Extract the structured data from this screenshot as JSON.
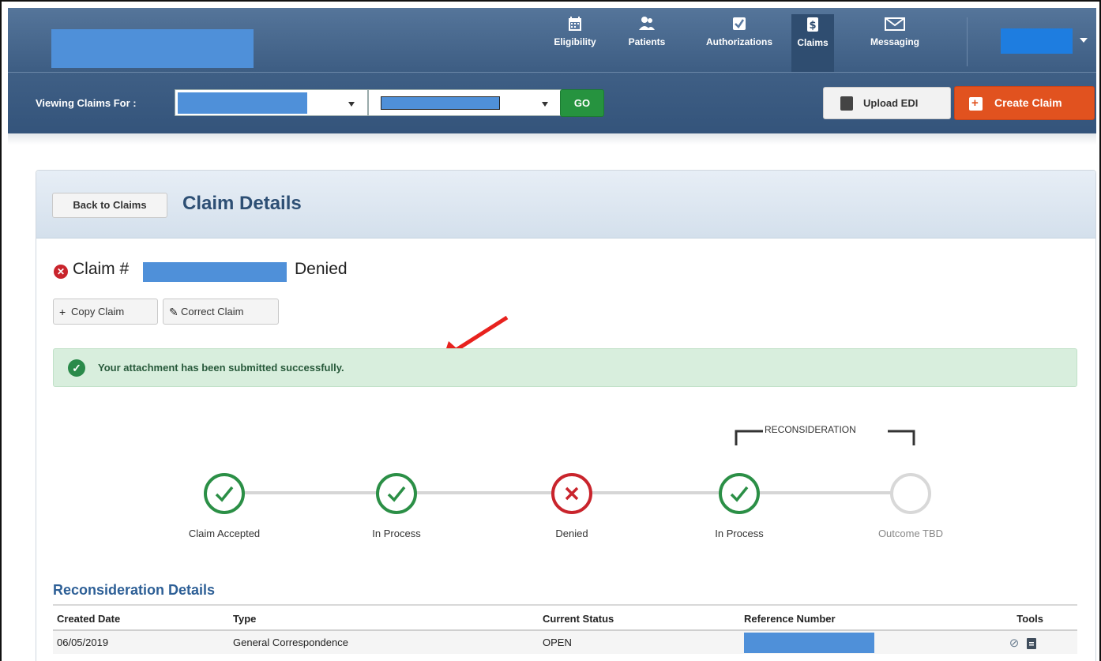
{
  "nav": {
    "items": [
      {
        "label": "Eligibility",
        "icon": "calendar-icon"
      },
      {
        "label": "Patients",
        "icon": "people-icon"
      },
      {
        "label": "Authorizations",
        "icon": "checkbox-icon"
      },
      {
        "label": "Claims",
        "icon": "dollar-icon",
        "active": true
      },
      {
        "label": "Messaging",
        "icon": "envelope-icon"
      }
    ]
  },
  "subbar": {
    "label": "Viewing Claims For :",
    "go_label": "GO",
    "upload_label": "Upload EDI",
    "create_label": "Create Claim"
  },
  "panel": {
    "back_label": "Back to Claims",
    "title": "Claim Details"
  },
  "claim": {
    "prefix": "Claim #",
    "status": "Denied",
    "copy_label": "Copy Claim",
    "correct_label": "Correct Claim"
  },
  "alert": {
    "message": "Your attachment has been submitted successfully."
  },
  "tracker": {
    "group_label": "RECONSIDERATION",
    "steps": [
      {
        "label": "Claim Accepted",
        "state": "done"
      },
      {
        "label": "In Process",
        "state": "done"
      },
      {
        "label": "Denied",
        "state": "error"
      },
      {
        "label": "In Process",
        "state": "done"
      },
      {
        "label": "Outcome TBD",
        "state": "pending"
      }
    ]
  },
  "reconsideration": {
    "title": "Reconsideration Details",
    "headers": [
      "Created Date",
      "Type",
      "Current Status",
      "Reference Number",
      "Tools"
    ],
    "rows": [
      {
        "created": "06/05/2019",
        "type": "General Correspondence",
        "status": "OPEN"
      }
    ]
  },
  "colors": {
    "nav_bg": "#3d5d83",
    "accent_green": "#26933f",
    "accent_orange": "#e1521f",
    "error_red": "#c9242c",
    "success_bg": "#d8eedd"
  }
}
